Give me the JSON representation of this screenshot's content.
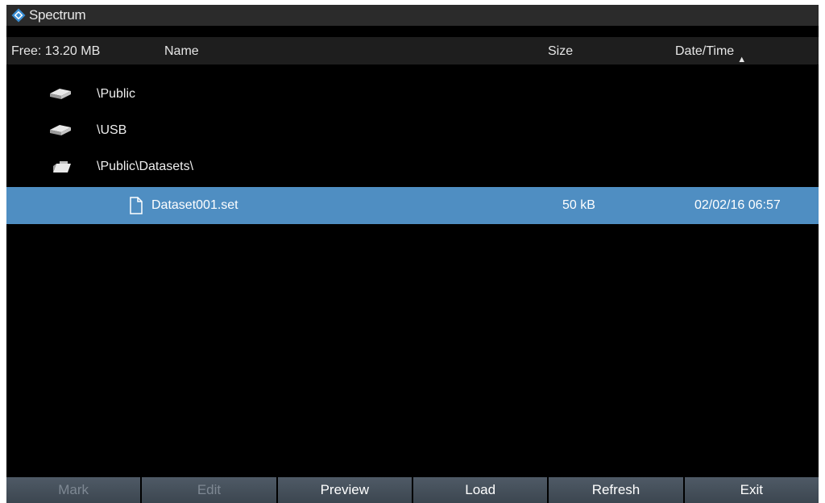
{
  "app": {
    "title": "Spectrum",
    "logo_icon": "diamond-logo-icon"
  },
  "header": {
    "free": "Free: 13.20 MB",
    "name": "Name",
    "size": "Size",
    "datetime": "Date/Time",
    "sort_indicator": "^"
  },
  "directories": [
    {
      "label": "\\Public",
      "icon": "drive-icon"
    },
    {
      "label": "\\USB",
      "icon": "drive-icon"
    },
    {
      "label": "\\Public\\Datasets\\",
      "icon": "open-folder-icon"
    }
  ],
  "files": [
    {
      "name": "Dataset001.set",
      "size": "50 kB",
      "date": "02/02/16 06:57",
      "icon": "file-icon",
      "selected": true
    }
  ],
  "softkeys": [
    {
      "label": "Mark",
      "enabled": false
    },
    {
      "label": "Edit",
      "enabled": false
    },
    {
      "label": "Preview",
      "enabled": true
    },
    {
      "label": "Load",
      "enabled": true
    },
    {
      "label": "Refresh",
      "enabled": true
    },
    {
      "label": "Exit",
      "enabled": true
    }
  ],
  "colors": {
    "selection": "#4f8ec2",
    "background": "#000000",
    "logo": "#3a8fd6"
  }
}
